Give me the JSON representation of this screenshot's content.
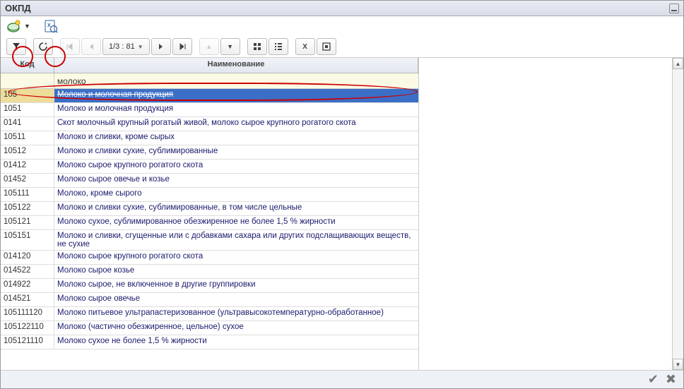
{
  "window": {
    "title": "ОКПД"
  },
  "toolbar2": {
    "page_info": "1/3 : 81"
  },
  "grid": {
    "header": {
      "code": "Код",
      "name": "Наименование"
    },
    "filter": {
      "code": "",
      "name": "молоко"
    }
  },
  "rows": [
    {
      "code": "105",
      "name": "Молоко и молочная продукция",
      "selected": true
    },
    {
      "code": "1051",
      "name": "Молоко и молочная продукция"
    },
    {
      "code": "0141",
      "name": "Скот молочный крупный рогатый живой, молоко сырое крупного рогатого скота"
    },
    {
      "code": "10511",
      "name": "Молоко и сливки, кроме сырых"
    },
    {
      "code": "10512",
      "name": "Молоко и сливки сухие, сублимированные"
    },
    {
      "code": "01412",
      "name": "Молоко сырое крупного рогатого скота"
    },
    {
      "code": "01452",
      "name": "Молоко сырое овечье и козье"
    },
    {
      "code": "105111",
      "name": "Молоко, кроме сырого"
    },
    {
      "code": "105122",
      "name": "Молоко и сливки сухие, сублимированные, в том числе цельные"
    },
    {
      "code": "105121",
      "name": "Молоко сухое, сублимированное обезжиренное не более 1,5 % жирности"
    },
    {
      "code": "105151",
      "name": "Молоко и сливки, сгущенные или с добавками сахара или других подслащивающих веществ, не сухие"
    },
    {
      "code": "014120",
      "name": "Молоко сырое крупного рогатого скота"
    },
    {
      "code": "014522",
      "name": "Молоко сырое козье"
    },
    {
      "code": "014922",
      "name": "Молоко сырое, не включенное в другие группировки"
    },
    {
      "code": "014521",
      "name": "Молоко сырое овечье"
    },
    {
      "code": "105111120",
      "name": "Молоко питьевое ультрапастеризованное (ультравысокотемпературно-обработанное)"
    },
    {
      "code": "105122110",
      "name": "Молоко (частично обезжиренное, цельное) сухое"
    },
    {
      "code": "105121110",
      "name": "Молоко сухое не более 1,5 % жирности"
    }
  ]
}
